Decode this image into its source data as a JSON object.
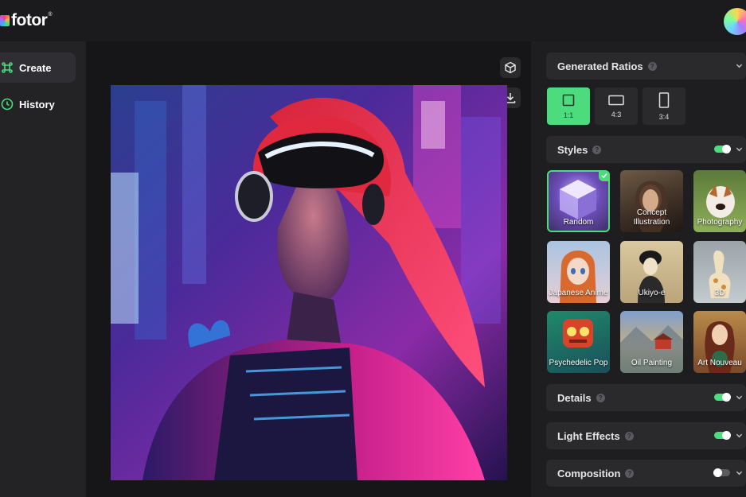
{
  "header": {
    "logo_text": "fotor",
    "logo_reg": "®"
  },
  "sidebar": {
    "items": [
      {
        "label": "Create",
        "icon": "command-icon",
        "active": true
      },
      {
        "label": "History",
        "icon": "clock-icon",
        "active": false
      }
    ]
  },
  "panel": {
    "ratios_title": "Generated Ratios",
    "ratios": [
      {
        "label": "1:1",
        "active": true
      },
      {
        "label": "4:3",
        "active": false
      },
      {
        "label": "3:4",
        "active": false
      }
    ],
    "styles_title": "Styles",
    "styles_enabled": true,
    "styles": [
      {
        "label": "Random",
        "active": true
      },
      {
        "label": "Concept Illustration",
        "active": false
      },
      {
        "label": "Photography",
        "active": false
      },
      {
        "label": "Japanese Anime",
        "active": false
      },
      {
        "label": "Ukiyo-e",
        "active": false
      },
      {
        "label": "3D",
        "active": false
      },
      {
        "label": "Psychedelic Pop",
        "active": false
      },
      {
        "label": "Oil Painting",
        "active": false
      },
      {
        "label": "Art Nouveau",
        "active": false
      }
    ],
    "details_title": "Details",
    "details_enabled": true,
    "light_title": "Light Effects",
    "light_enabled": true,
    "composition_title": "Composition",
    "composition_enabled": false
  },
  "colors": {
    "accent": "#4ddc7d",
    "background": "#1b1b1d",
    "panel": "#2a2a2d"
  }
}
